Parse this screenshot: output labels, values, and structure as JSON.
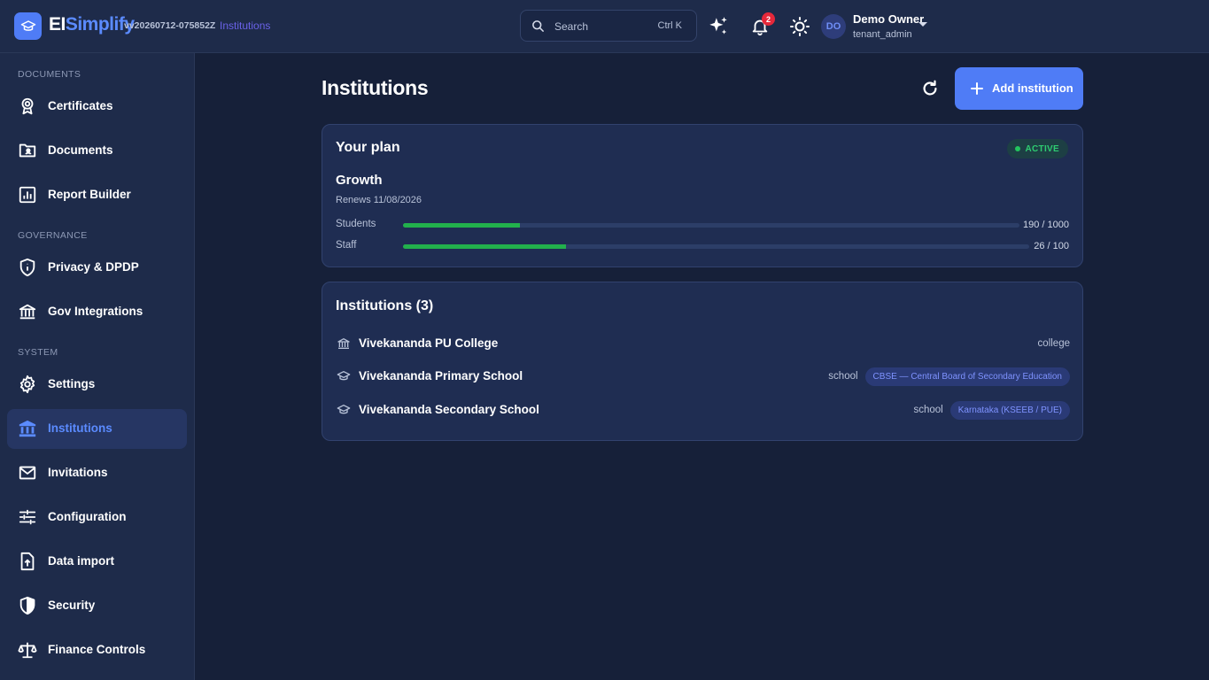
{
  "app": {
    "brand_part1": "EI",
    "brand_part2": "Simplify",
    "version": "vv20260712-075852Z",
    "breadcrumb": "Institutions"
  },
  "topbar": {
    "search_placeholder": "Search",
    "search_shortcut": "Ctrl K",
    "notification_count": "2",
    "user": {
      "initials": "DO",
      "name": "Demo Owner",
      "role": "tenant_admin"
    }
  },
  "sidebar": {
    "sections": [
      {
        "heading": "DOCUMENTS",
        "items": [
          {
            "label": "Certificates",
            "icon": "award-icon"
          },
          {
            "label": "Documents",
            "icon": "folder-user-icon"
          },
          {
            "label": "Report Builder",
            "icon": "bar-chart-icon"
          }
        ]
      },
      {
        "heading": "GOVERNANCE",
        "items": [
          {
            "label": "Privacy & DPDP",
            "icon": "shield-info-icon"
          },
          {
            "label": "Gov Integrations",
            "icon": "bank-icon"
          }
        ]
      },
      {
        "heading": "SYSTEM",
        "items": [
          {
            "label": "Settings",
            "icon": "gear-icon"
          },
          {
            "label": "Institutions",
            "icon": "institution-icon",
            "active": true
          },
          {
            "label": "Invitations",
            "icon": "mail-icon"
          },
          {
            "label": "Configuration",
            "icon": "sliders-icon"
          },
          {
            "label": "Data import",
            "icon": "file-upload-icon"
          },
          {
            "label": "Security",
            "icon": "shield-icon"
          },
          {
            "label": "Finance Controls",
            "icon": "scale-icon"
          }
        ]
      }
    ]
  },
  "main": {
    "title": "Institutions",
    "add_button": "Add institution",
    "plan": {
      "heading": "Your plan",
      "status": "ACTIVE",
      "name": "Growth",
      "renews": "Renews 11/08/2026",
      "usage": [
        {
          "label": "Students",
          "used": 190,
          "limit": 1000,
          "display": "190 / 1000",
          "fraction": 0.19
        },
        {
          "label": "Staff",
          "used": 26,
          "limit": 100,
          "display": "26 / 100",
          "fraction": 0.26
        }
      ]
    },
    "institutions": {
      "heading": "Institutions (3)",
      "items": [
        {
          "name": "Vivekananda PU College",
          "type": "college",
          "board": "",
          "icon": "bank-icon"
        },
        {
          "name": "Vivekananda Primary School",
          "type": "school",
          "board": "CBSE — Central Board of Secondary Education",
          "icon": "graduation-cap-icon"
        },
        {
          "name": "Vivekananda Secondary School",
          "type": "school",
          "board": "Karnataka (KSEEB / PUE)",
          "icon": "graduation-cap-icon"
        }
      ]
    }
  },
  "colors": {
    "accent": "#4f7cf6",
    "background": "#162039",
    "panel": "#1e2b4a",
    "card": "#1f2d52",
    "progress": "#22b14c",
    "active_status": "#2ecc71",
    "badge": "#e5283a"
  }
}
